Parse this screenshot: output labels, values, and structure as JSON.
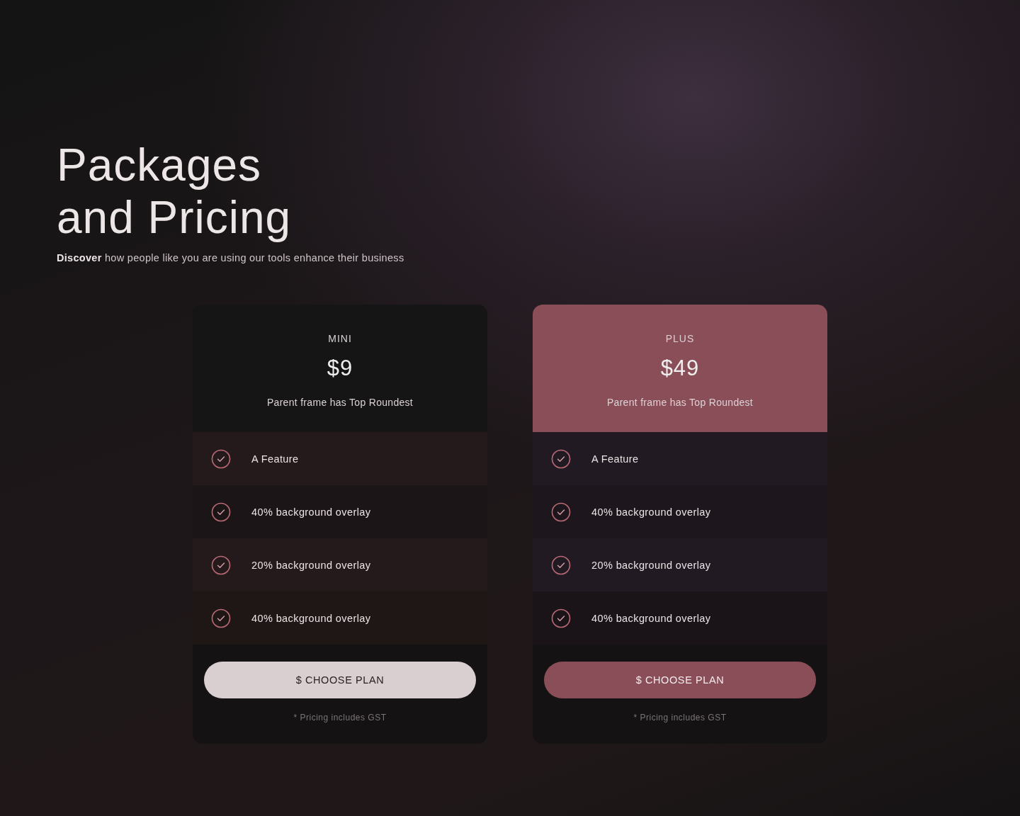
{
  "heading": {
    "title_lines": [
      "Packages",
      "and Pricing"
    ],
    "subtitle": "**Discover** how people like you are using our tools enhance their business"
  },
  "plans": [
    {
      "name": "MINI",
      "price": "$9",
      "description": "Parent frame has Top Roundest",
      "highlighted": false,
      "features": [
        "A Feature",
        "40% background overlay",
        "20% background overlay",
        "40% background overlay"
      ],
      "button": "$ CHOOSE PLAN",
      "note": "* Pricing includes GST"
    },
    {
      "name": "PLUS",
      "price": "$49",
      "description": "Parent frame has Top Roundest",
      "highlighted": true,
      "features": [
        "A Feature",
        "40% background overlay",
        "20% background overlay",
        "40% background overlay"
      ],
      "button": "$ CHOOSE PLAN",
      "note": "* Pricing includes GST"
    }
  ]
}
